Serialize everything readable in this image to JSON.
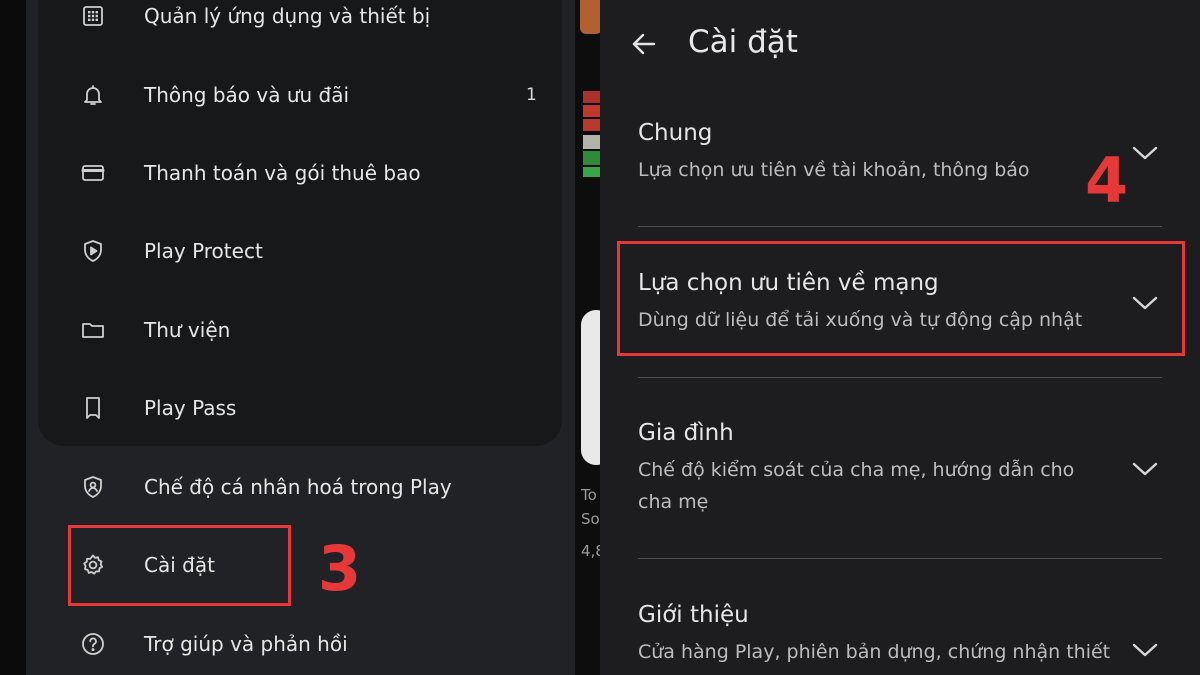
{
  "left_menu": {
    "items": [
      {
        "label": "Quản lý ứng dụng và thiết bị",
        "icon": "grid-icon",
        "count": ""
      },
      {
        "label": "Thông báo và ưu đãi",
        "icon": "bell-icon",
        "count": "1"
      },
      {
        "label": "Thanh toán và gói thuê bao",
        "icon": "credit-card-icon",
        "count": ""
      },
      {
        "label": "Play Protect",
        "icon": "shield-play-icon",
        "count": ""
      },
      {
        "label": "Thư viện",
        "icon": "folder-icon",
        "count": ""
      },
      {
        "label": "Play Pass",
        "icon": "ticket-icon",
        "count": ""
      },
      {
        "label": "Chế độ cá nhân hoá trong Play",
        "icon": "shield-person-icon",
        "count": ""
      },
      {
        "label": "Cài đặt",
        "icon": "gear-icon",
        "count": ""
      },
      {
        "label": "Trợ giúp và phản hồi",
        "icon": "help-icon",
        "count": ""
      }
    ]
  },
  "background_strip": {
    "lines": [
      "To",
      "So",
      "4,8"
    ]
  },
  "settings": {
    "title": "Cài đặt",
    "sections": [
      {
        "title": "Chung",
        "desc": "Lựa chọn ưu tiên về tài khoản, thông báo"
      },
      {
        "title": "Lựa chọn ưu tiên về mạng",
        "desc": "Dùng dữ liệu để tải xuống và tự động cập nhật"
      },
      {
        "title": "Gia đình",
        "desc": "Chế độ kiểm soát của cha mẹ, hướng dẫn cho cha mẹ"
      },
      {
        "title": "Giới thiệu",
        "desc": "Cửa hàng Play, phiên bản dựng, chứng nhận thiết"
      }
    ]
  },
  "annotations": {
    "step_left": "3",
    "step_right": "4",
    "color": "#e63838"
  }
}
